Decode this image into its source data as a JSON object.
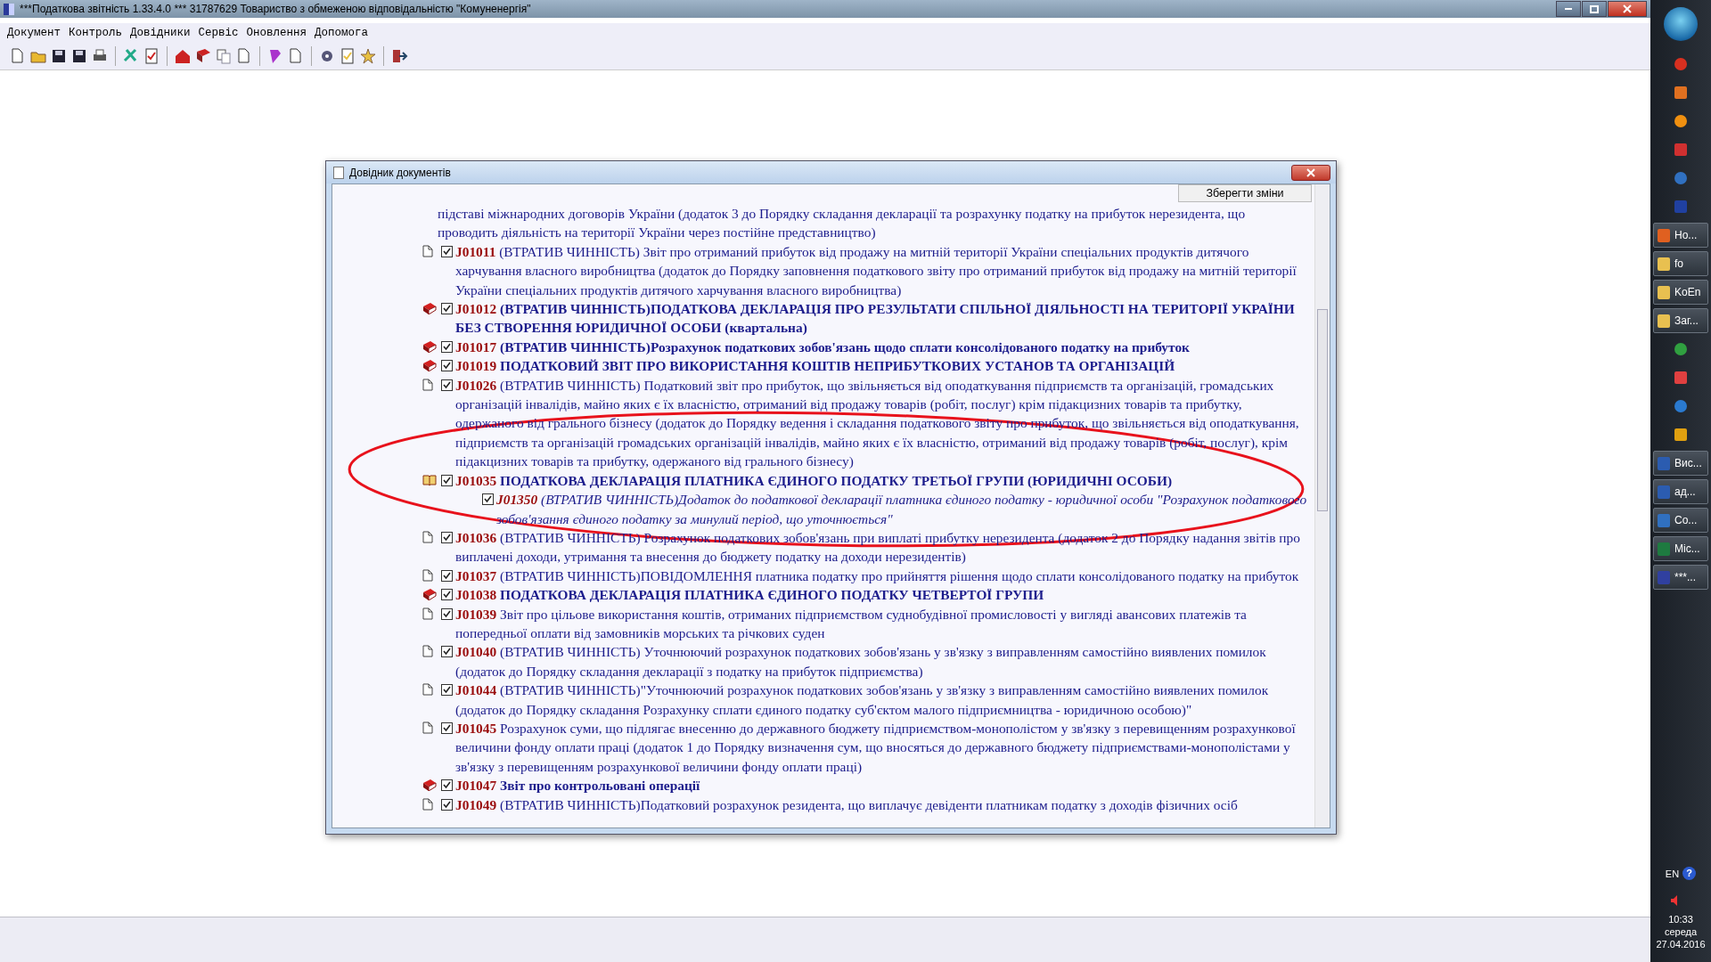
{
  "window": {
    "title": "***Податкова звітність 1.33.4.0 *** 31787629 Товариство з обмеженою відповідальністю \"Комуненергія\""
  },
  "menu": [
    "Документ",
    "Контроль",
    "Довідники",
    "Сервіс",
    "Оновлення",
    "Допомога"
  ],
  "dialog": {
    "title": "Довідник документів",
    "save_button": "Зберегти зміни",
    "documents": [
      {
        "kind": "continuation",
        "bold": false,
        "italic": false,
        "text": "підставі міжнародних договорів України (додаток 3 до Порядку складання декларації та розрахунку податку на прибуток нерезидента, що проводить діяльність на території України через постійне представництво)"
      },
      {
        "kind": "page",
        "checked": true,
        "code": "J01011",
        "bold": false,
        "italic": false,
        "text": "(ВТРАТИВ ЧИННІСТЬ) Звіт про отриманий прибуток від продажу на митній території України спеціальних продуктів дитячого харчування власного виробництва (додаток до Порядку заповнення податкового звіту про отриманий прибуток від продажу на митній території України спеціальних продуктів дитячого харчування власного виробництва)"
      },
      {
        "kind": "book",
        "checked": true,
        "code": "J01012",
        "bold": true,
        "italic": false,
        "text": "(ВТРАТИВ ЧИННІСТЬ)ПОДАТКОВА ДЕКЛАРАЦІЯ ПРО РЕЗУЛЬТАТИ СПІЛЬНОЇ ДІЯЛЬНОСТІ НА ТЕРИТОРІЇ УКРАЇНИ БЕЗ СТВОРЕННЯ ЮРИДИЧНОЇ ОСОБИ (квартальна)"
      },
      {
        "kind": "book",
        "checked": true,
        "code": "J01017",
        "bold": true,
        "italic": false,
        "text": "(ВТРАТИВ ЧИННІСТЬ)Розрахунок податкових зобов'язань щодо сплати консолідованого податку на прибуток"
      },
      {
        "kind": "book",
        "checked": true,
        "code": "J01019",
        "bold": true,
        "italic": false,
        "text": "ПОДАТКОВИЙ ЗВІТ ПРО ВИКОРИСТАННЯ КОШТІВ НЕПРИБУТКОВИХ УСТАНОВ ТА ОРГАНІЗАЦІЙ"
      },
      {
        "kind": "page",
        "checked": true,
        "code": "J01026",
        "bold": false,
        "italic": false,
        "text": "(ВТРАТИВ ЧИННІСТЬ) Податковий звіт про прибуток, що звільняється від оподаткування підприємств та організацій, громадських організацій інвалідів, майно яких є їх власністю, отриманий від продажу товарів (робіт, послуг) крім підакцизних товарів та прибутку, одержаного від грального бізнесу (додаток до Порядку ведення і складання податкового звіту про прибуток, що звільняється від оподаткування, підприємств та організацій громадських організацій інвалідів, майно яких є їх власністю, отриманий від продажу товарів (робіт, послуг), крім підакцизних товарів та прибутку, одержаного від грального бізнесу)"
      },
      {
        "kind": "open-book",
        "checked": true,
        "code": "J01035",
        "bold": true,
        "italic": false,
        "text": "ПОДАТКОВА ДЕКЛАРАЦІЯ ПЛАТНИКА ЄДИНОГО ПОДАТКУ ТРЕТЬОЇ ГРУПИ (ЮРИДИЧНІ ОСОБИ)",
        "children": [
          {
            "checked": true,
            "code": "J01350",
            "bold": false,
            "italic": true,
            "text": "(ВТРАТИВ ЧИННІСТЬ)Додаток до податкової декларації платника єдиного податку - юридичної особи \"Розрахунок податкового зобов'язання єдиного податку за минулий період, що уточнюється\""
          }
        ]
      },
      {
        "kind": "page",
        "checked": true,
        "code": "J01036",
        "bold": false,
        "italic": false,
        "text": "(ВТРАТИВ ЧИННІСТЬ) Розрахунок податкових зобов'язань при виплаті прибутку нерезидента (додаток 2 до Порядку надання звітів про виплачені доходи, утримання та внесення до бюджету податку на доходи нерезидентів)"
      },
      {
        "kind": "page",
        "checked": true,
        "code": "J01037",
        "bold": false,
        "italic": false,
        "text": "(ВТРАТИВ ЧИННІСТЬ)ПОВІДОМЛЕННЯ платника податку про прийняття рішення щодо сплати консолідованого податку на прибуток"
      },
      {
        "kind": "book",
        "checked": true,
        "code": "J01038",
        "bold": true,
        "italic": false,
        "text": "ПОДАТКОВА ДЕКЛАРАЦІЯ ПЛАТНИКА ЄДИНОГО ПОДАТКУ ЧЕТВЕРТОЇ ГРУПИ"
      },
      {
        "kind": "page",
        "checked": true,
        "code": "J01039",
        "bold": false,
        "italic": false,
        "text": "Звіт про цільове використання коштів, отриманих підприємством суднобудівної промисловості у вигляді авансових платежів та попередньої оплати від замовників морських та річкових суден"
      },
      {
        "kind": "page",
        "checked": true,
        "code": "J01040",
        "bold": false,
        "italic": false,
        "text": "(ВТРАТИВ ЧИННІСТЬ) Уточнюючий розрахунок податкових зобов'язань у зв'язку з виправленням самостійно виявлених помилок (додаток до Порядку складання декларації з податку на прибуток підприємства)"
      },
      {
        "kind": "page",
        "checked": true,
        "code": "J01044",
        "bold": false,
        "italic": false,
        "text": "(ВТРАТИВ ЧИННІСТЬ)\"Уточнюючий розрахунок податкових зобов'язань у зв'язку з виправленням самостійно виявлених помилок (додаток до Порядку складання Розрахунку сплати єдиного податку суб'єктом малого підприємництва - юридичною особою)\""
      },
      {
        "kind": "page",
        "checked": true,
        "code": "J01045",
        "bold": false,
        "italic": false,
        "text": "Розрахунок суми, що підлягає внесенню до державного бюджету підприємством-монополістом у зв'язку з перевищенням розрахункової величини фонду оплати праці (додаток 1 до Порядку визначення сум, що вносяться до державного бюджету підприємствами-монополістами у зв'язку з перевищенням розрахункової величини фонду оплати праці)"
      },
      {
        "kind": "book",
        "checked": true,
        "code": "J01047",
        "bold": true,
        "italic": false,
        "text": "Звіт про контрольовані операції"
      },
      {
        "kind": "page",
        "checked": true,
        "code": "J01049",
        "bold": false,
        "italic": false,
        "text": "(ВТРАТИВ ЧИННІСТЬ)Податковий розрахунок резидента, що виплачує девіденти платникам податку з доходів фізичних осіб"
      }
    ]
  },
  "taskbar": {
    "items": [
      {
        "kind": "icon"
      },
      {
        "kind": "icon"
      },
      {
        "kind": "icon"
      },
      {
        "kind": "icon"
      },
      {
        "kind": "icon"
      },
      {
        "kind": "icon"
      },
      {
        "kind": "button",
        "label": "Но..."
      },
      {
        "kind": "button",
        "label": "fo"
      },
      {
        "kind": "button",
        "label": "KoEn"
      },
      {
        "kind": "button",
        "label": "Заг..."
      },
      {
        "kind": "icon"
      },
      {
        "kind": "icon"
      },
      {
        "kind": "icon"
      },
      {
        "kind": "icon"
      },
      {
        "kind": "button",
        "label": "Вис..."
      },
      {
        "kind": "button",
        "label": "ад..."
      },
      {
        "kind": "button",
        "label": "Co..."
      },
      {
        "kind": "button",
        "label": "Mic..."
      },
      {
        "kind": "button",
        "label": "***..."
      }
    ],
    "language": "EN",
    "help": "?",
    "time": "10:33",
    "weekday": "середа",
    "date": "27.04.2016"
  }
}
